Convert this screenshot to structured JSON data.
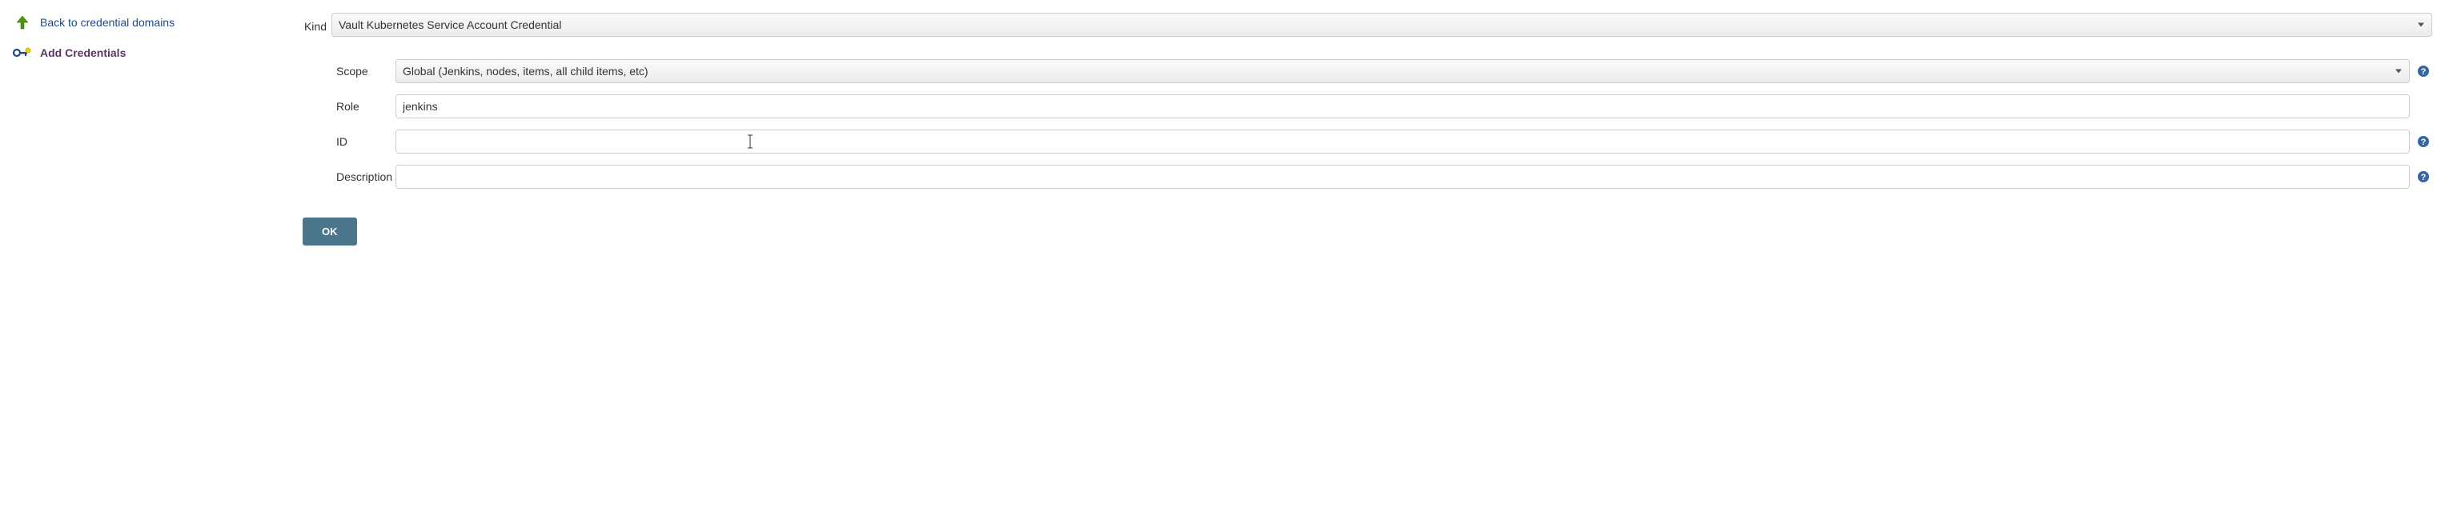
{
  "sidebar": {
    "back": {
      "label": "Back to credential domains"
    },
    "add": {
      "label": "Add Credentials"
    }
  },
  "form": {
    "kind": {
      "label": "Kind",
      "value": "Vault Kubernetes Service Account Credential"
    },
    "scope": {
      "label": "Scope",
      "value": "Global (Jenkins, nodes, items, all child items, etc)"
    },
    "role": {
      "label": "Role",
      "value": "jenkins"
    },
    "id": {
      "label": "ID",
      "value": ""
    },
    "description": {
      "label": "Description",
      "value": ""
    },
    "submit": "OK"
  }
}
